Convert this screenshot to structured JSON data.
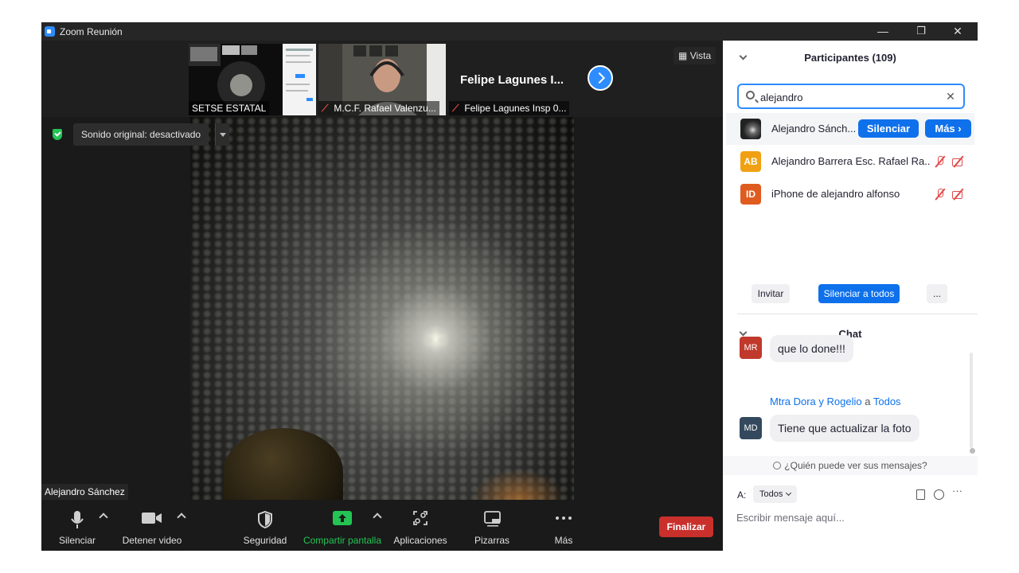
{
  "window": {
    "title": "Zoom Reunión",
    "minimize": "—",
    "restore": "❐",
    "close": "✕"
  },
  "stage": {
    "thumbnails": [
      {
        "name": "SETSE ESTATAL",
        "muted": false
      },
      {
        "name": "M.C.F. Rafael Valenzu...",
        "muted": true
      },
      {
        "name": "Felipe Lagunes Insp 0...",
        "muted": true,
        "display_name": "Felipe Lagunes I..."
      }
    ],
    "view_label": "Vista",
    "original_sound": "Sonido original: desactivado",
    "active_speaker": "Alejandro Sánchez"
  },
  "toolbar": {
    "mute": "Silenciar",
    "stop_video": "Detener video",
    "security": "Seguridad",
    "share_screen": "Compartir pantalla",
    "apps": "Aplicaciones",
    "whiteboards": "Pizarras",
    "more": "Más",
    "end": "Finalizar",
    "share_color": "#23c454"
  },
  "participants": {
    "header": "Participantes (109)",
    "search_value": "alejandro",
    "clear": "✕",
    "list": [
      {
        "name": "Alejandro Sánch...",
        "initials": "",
        "color": "#111111",
        "mute_btn": "Silenciar",
        "more_btn": "Más ›"
      },
      {
        "name": "Alejandro Barrera Esc. Rafael Ra...",
        "initials": "AB",
        "color": "#f0a012"
      },
      {
        "name": "iPhone de alejandro alfonso",
        "initials": "ID",
        "color": "#e05b1f"
      }
    ],
    "invite": "Invitar",
    "mute_all": "Silenciar a todos",
    "more": "..."
  },
  "chat": {
    "header": "Chat",
    "messages": [
      {
        "initials": "MR",
        "color": "#c0392b",
        "text": "que lo done!!!"
      },
      {
        "sender": "Mtra Dora y Rogelio",
        "to_word": "a",
        "recipient": "Todos",
        "initials": "MD",
        "color": "#34495e",
        "text": "Tiene que actualizar la foto"
      }
    ],
    "who_can_see": "¿Quién puede ver sus mensajes?",
    "to_label": "A:",
    "to_value": "Todos",
    "more": "···",
    "input_placeholder": "Escribir mensaje aquí..."
  }
}
